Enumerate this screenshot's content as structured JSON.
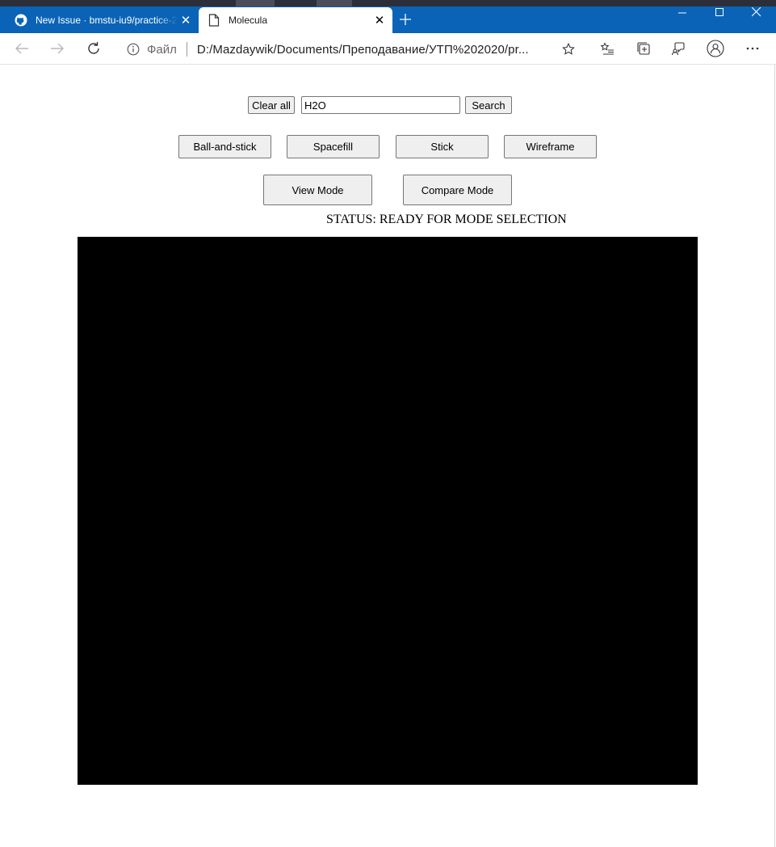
{
  "browser": {
    "tabs": [
      {
        "label": "New Issue · bmstu-iu9/practice-2",
        "active": false,
        "icon": "github-icon"
      },
      {
        "label": "Molecula",
        "active": true,
        "icon": "page-icon"
      }
    ],
    "address": {
      "scheme_label": "Файл",
      "url": "D:/Mazdaywik/Documents/Преподавание/УТП%202020/pr..."
    },
    "colors": {
      "titlebar": "#0a63b6"
    }
  },
  "controls": {
    "clear_all_label": "Clear all",
    "search_value": "H2O",
    "search_label": "Search",
    "render_modes": [
      "Ball-and-stick",
      "Spacefill",
      "Stick",
      "Wireframe"
    ],
    "view_mode_label": "View Mode",
    "compare_mode_label": "Compare Mode"
  },
  "status": {
    "text": "STATUS: READY FOR MODE SELECTION"
  },
  "viewer": {
    "background": "#000000"
  }
}
